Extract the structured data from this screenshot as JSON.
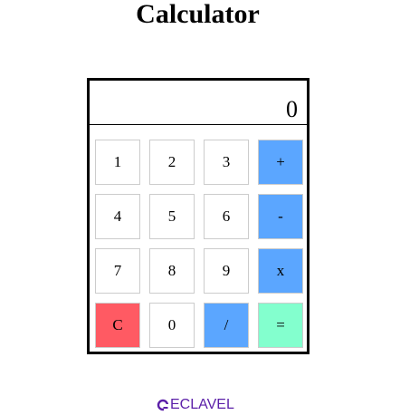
{
  "page": {
    "title": "Calculator"
  },
  "display": {
    "value": "0"
  },
  "keys": [
    {
      "label": "1"
    },
    {
      "label": "2"
    },
    {
      "label": "3"
    },
    {
      "label": "+"
    },
    {
      "label": "4"
    },
    {
      "label": "5"
    },
    {
      "label": "6"
    },
    {
      "label": "-"
    },
    {
      "label": "7"
    },
    {
      "label": "8"
    },
    {
      "label": "9"
    },
    {
      "label": "x"
    },
    {
      "label": "C"
    },
    {
      "label": "0"
    },
    {
      "label": "/"
    },
    {
      "label": "="
    }
  ],
  "colors": {
    "operator": "#5ba6ff",
    "clear": "#ff5a63",
    "equals": "#83ffce",
    "brand": "#5b1fa8"
  },
  "footer": {
    "logo_text": "ECLAVEL",
    "logo_icon": "brand-logo-icon"
  }
}
